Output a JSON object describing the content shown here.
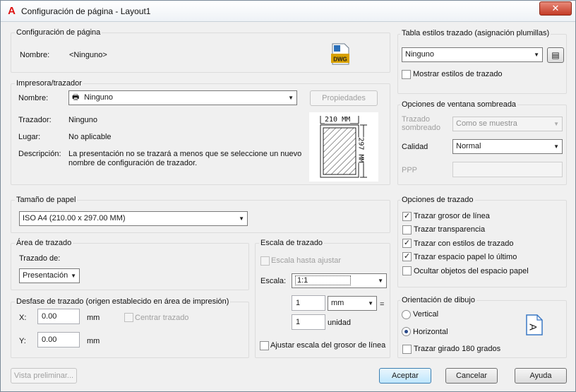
{
  "window": {
    "title": "Configuración de página - Layout1",
    "close": "✕"
  },
  "page_setup": {
    "heading": "Configuración de página",
    "name_label": "Nombre:",
    "name_value": "<Ninguno>",
    "file_badge": "DWG"
  },
  "printer": {
    "heading": "Impresora/trazador",
    "name_label": "Nombre:",
    "name_value": "Ninguno",
    "properties_button": "Propiedades",
    "plotter_label": "Trazador:",
    "plotter_value": "Ninguno",
    "location_label": "Lugar:",
    "location_value": "No aplicable",
    "description_label": "Descripción:",
    "description_line1": "La presentación no se trazará a menos que se seleccione un nuevo",
    "description_line2": "nombre de configuración de trazador.",
    "paper_width": "210 MM",
    "paper_height": "297 MM"
  },
  "paper_size": {
    "heading": "Tamaño de papel",
    "value": "ISO A4 (210.00 x 297.00 MM)"
  },
  "plot_area": {
    "heading": "Área de trazado",
    "what_label": "Trazado de:",
    "what_value": "Presentación"
  },
  "plot_offset": {
    "heading": "Desfase de trazado (origen establecido en área de impresión)",
    "x_label": "X:",
    "x_value": "0.00",
    "x_unit": "mm",
    "y_label": "Y:",
    "y_value": "0.00",
    "y_unit": "mm",
    "center_label": "Centrar trazado"
  },
  "plot_scale": {
    "heading": "Escala de trazado",
    "fit_label": "Escala hasta ajustar",
    "scale_label": "Escala:",
    "scale_value": "1:1",
    "num_value": "1",
    "unit_value": "mm",
    "equals": "=",
    "den_value": "1",
    "den_unit": "unidad",
    "lineweight_label": "Ajustar escala del grosor de línea"
  },
  "style_table": {
    "heading": "Tabla estilos trazado (asignación plumillas)",
    "value": "Ninguno",
    "show_label": "Mostrar estilos de trazado"
  },
  "shaded": {
    "heading": "Opciones de ventana sombreada",
    "shade_label1": "Trazado",
    "shade_label2": "sombreado",
    "shade_value": "Como se muestra",
    "quality_label": "Calidad",
    "quality_value": "Normal",
    "dpi_label": "PPP"
  },
  "plot_options": {
    "heading": "Opciones de trazado",
    "items": [
      {
        "label": "Trazar grosor de línea",
        "checked": true
      },
      {
        "label": "Trazar transparencia",
        "checked": false
      },
      {
        "label": "Trazar con estilos de trazado",
        "checked": true
      },
      {
        "label": "Trazar espacio papel lo último",
        "checked": true
      },
      {
        "label": "Ocultar objetos del espacio papel",
        "checked": false
      }
    ]
  },
  "orientation": {
    "heading": "Orientación de dibujo",
    "portrait": "Vertical",
    "landscape": "Horizontal",
    "upside_down": "Trazar girado 180 grados",
    "icon_letter": "A"
  },
  "footer": {
    "preview": "Vista preliminar...",
    "ok": "Aceptar",
    "cancel": "Cancelar",
    "help": "Ayuda"
  }
}
